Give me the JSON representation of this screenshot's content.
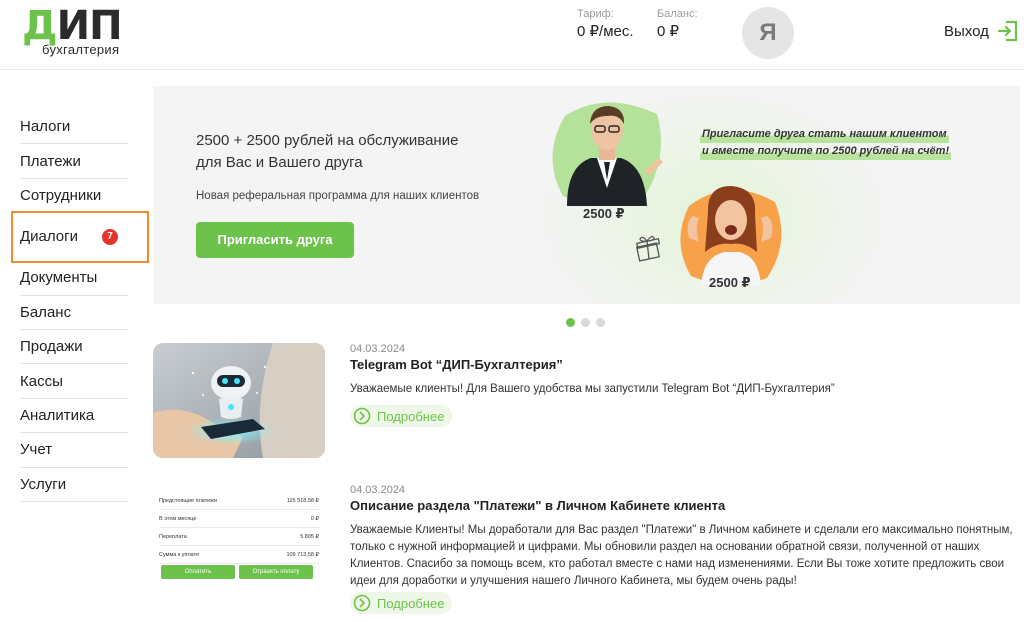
{
  "header": {
    "logo_main": "ДИП",
    "logo_sub": "бухгалтерия",
    "tariff_caption": "Тариф:",
    "tariff_value": "0 ₽/мес.",
    "balance_caption": "Баланс:",
    "balance_value": "0 ₽",
    "avatar_letter": "Я",
    "logout_label": "Выход"
  },
  "sidebar": {
    "items": [
      {
        "label": "Налоги"
      },
      {
        "label": "Платежи"
      },
      {
        "label": "Сотрудники"
      },
      {
        "label": "Диалоги",
        "badge": "7",
        "active": true
      },
      {
        "label": "Документы"
      },
      {
        "label": "Баланс"
      },
      {
        "label": "Продажи"
      },
      {
        "label": "Кассы"
      },
      {
        "label": "Аналитика"
      },
      {
        "label": "Учет"
      },
      {
        "label": "Услуги"
      }
    ]
  },
  "banner": {
    "title_line1": "2500 + 2500 рублей на обслуживание",
    "title_line2": "для Вас и Вашего друга",
    "subtitle": "Новая реферальная программа для наших клиентов",
    "button_label": "Пригласить друга",
    "promo_line1": "Пригласите друга стать нашим клиентом",
    "promo_line2": "и вместе получите по 2500 рублей на счёт!",
    "amount_1": "2500 ₽",
    "amount_2": "2500 ₽",
    "slides_total": 3,
    "slide_active": 1
  },
  "news": [
    {
      "date": "04.03.2024",
      "title": "Telegram Bot “ДИП-Бухгалтерия”",
      "text": "Уважаемые клиенты! Для Вашего удобства мы запустили Telegram Bot “ДИП-Бухгалтерия”",
      "more_label": "Подробнее"
    },
    {
      "date": "04.03.2024",
      "title": "Описание раздела \"Платежи\" в Личном Кабинете клиента",
      "text": "Уважаемые Клиенты! Мы доработали для Вас раздел \"Платежи\" в Личном кабинете и сделали его максимально понятным, только с нужной информацией и цифрами. Мы обновили раздел на основании обратной связи, полученной от наших Клиентов. Спасибо за помощь всем, кто работал вместе с нами над изменениями. Если Вы тоже хотите предложить свои идеи для доработки и улучшения нашего Личного Кабинета, мы будем очень рады!",
      "more_label": "Подробнее",
      "thumb": {
        "rows": [
          {
            "label": "Предстоящие платежи",
            "value": "115 518,58 ₽"
          },
          {
            "label": "В этом месяце",
            "value": "0 ₽"
          },
          {
            "label": "Переплата",
            "value": "5 805 ₽"
          },
          {
            "label": "Сумма к уплате",
            "value": "109 713,58 ₽"
          }
        ],
        "pay_label": "Оплатить",
        "defer_label": "Отразить оплату"
      }
    }
  ],
  "colors": {
    "accent": "#6cc24a",
    "badge": "#e8332b",
    "active_outline": "#f08c2e"
  }
}
